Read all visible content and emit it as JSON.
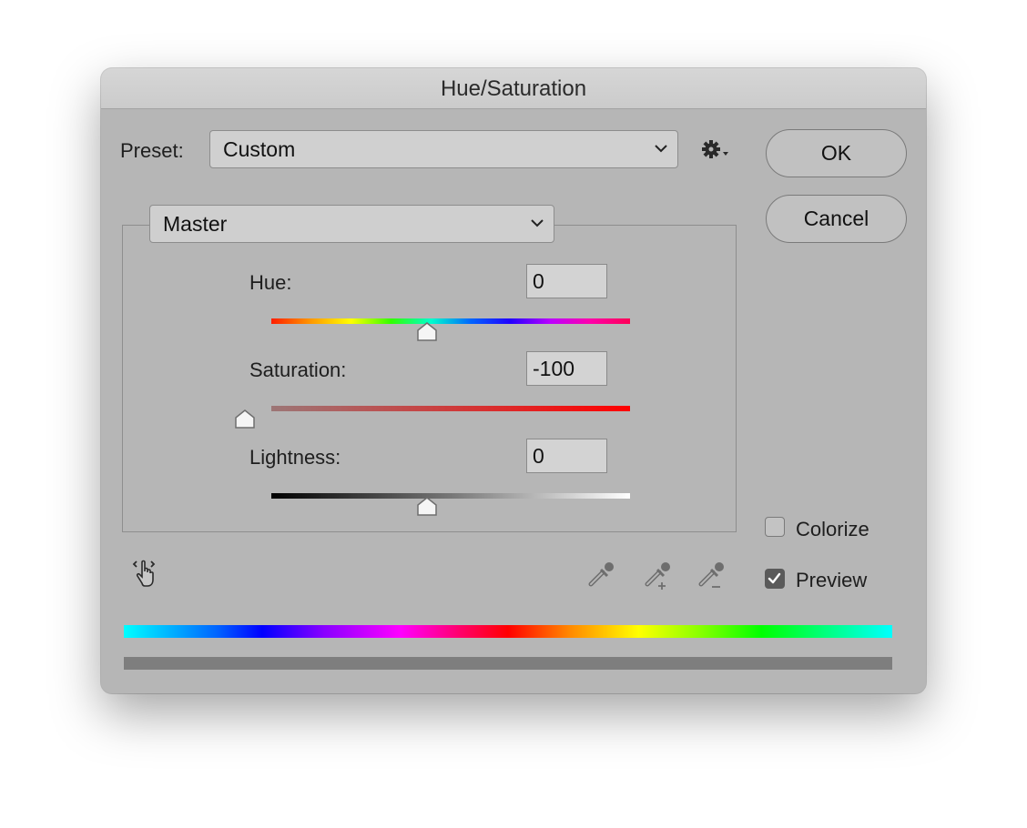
{
  "window": {
    "title": "Hue/Saturation"
  },
  "preset": {
    "label": "Preset:",
    "value": "Custom"
  },
  "channel": {
    "value": "Master"
  },
  "buttons": {
    "ok": "OK",
    "cancel": "Cancel"
  },
  "sliders": [
    {
      "label": "Hue:",
      "value": "0",
      "position": 0.5
    },
    {
      "label": "Saturation:",
      "value": "-100",
      "position": 0.0
    },
    {
      "label": "Lightness:",
      "value": "0",
      "position": 0.5
    }
  ],
  "options": {
    "colorize": {
      "label": "Colorize",
      "checked": false
    },
    "preview": {
      "label": "Preview",
      "checked": true
    }
  },
  "icons": {
    "settings": "gear-icon",
    "targeted_adjustment": "hand-scrub-icon",
    "eyedropper": "eyedropper-icon",
    "eyedropper_add": "eyedropper-plus-icon",
    "eyedropper_subtract": "eyedropper-minus-icon"
  },
  "colors": {
    "dialog_bg": "#b6b6b6",
    "saturation_track_start": "#9c7676",
    "saturation_track_end": "#ff0000",
    "preview_bar": "#7e7e7e"
  }
}
